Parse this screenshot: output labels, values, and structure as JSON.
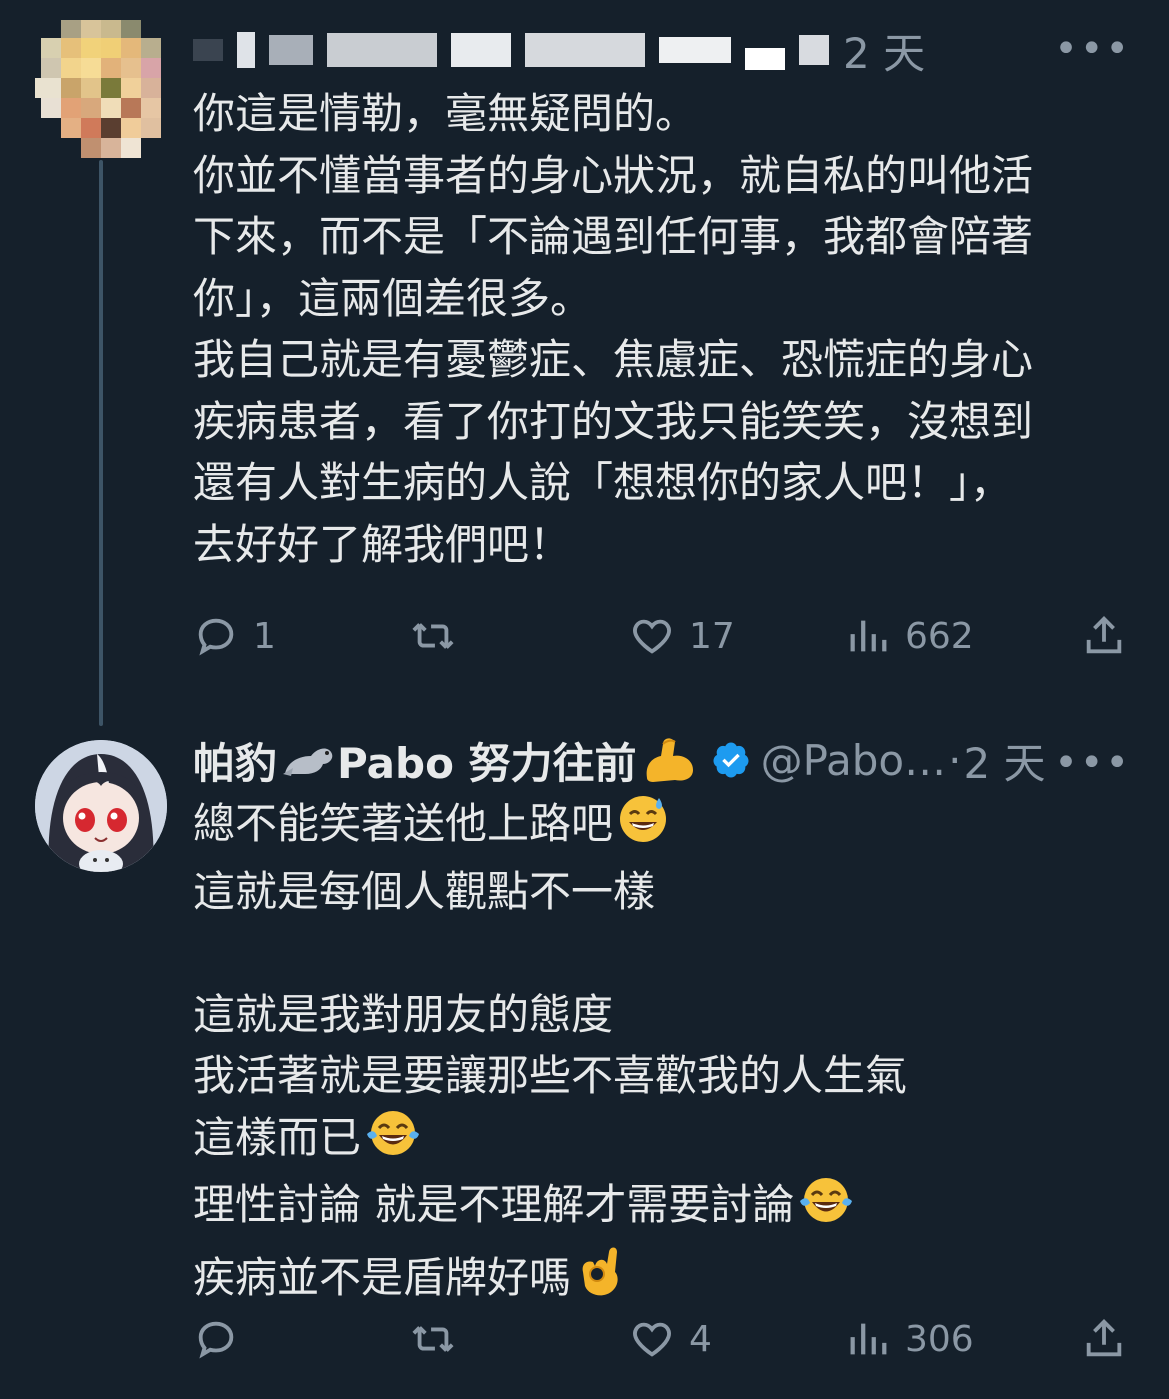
{
  "tweets": [
    {
      "timestamp": "2 天",
      "more_icon": "more-horizontal-icon",
      "lines": [
        "你這是情勒，毫無疑問的。",
        "你並不懂當事者的身心狀況，就自私的叫他活",
        "下來，而不是「不論遇到任何事，我都會陪著",
        "你」，這兩個差很多。",
        "我自己就是有憂鬱症、焦慮症、恐慌症的身心",
        "疾病患者，看了你打的文我只能笑笑，沒想到",
        "還有人對生病的人說「想想你的家人吧！」，",
        "去好好了解我們吧！"
      ],
      "actions": {
        "reply_count": "1",
        "retweet_count": "",
        "like_count": "17",
        "views_count": "662"
      }
    },
    {
      "display_name": "帕豹",
      "display_name_suffix": "Pabo 努力往前",
      "handle": "@Pabo…",
      "separator": "·",
      "timestamp": "2 天",
      "verified_color": "#1d9bf0",
      "lines": [
        "總不能笑著送他上路吧",
        "這就是每個人觀點不一樣",
        "",
        "這就是我對朋友的態度",
        "我活著就是要讓那些不喜歡我的人生氣",
        "這樣而已",
        "理性討論 就是不理解才需要討論",
        "疾病並不是盾牌好嗎"
      ],
      "line_emojis": [
        "sweat-smile-emoji",
        "",
        "",
        "",
        "",
        "tears-of-joy-emoji",
        "tears-of-joy-emoji",
        "ok-hand-emoji"
      ],
      "actions": {
        "reply_count": "",
        "retweet_count": "",
        "like_count": "4",
        "views_count": "306"
      }
    }
  ],
  "colors": {
    "background": "#15202b",
    "text": "#e7e9ea",
    "muted": "#8b98a5",
    "thread_line": "#3d5466"
  }
}
